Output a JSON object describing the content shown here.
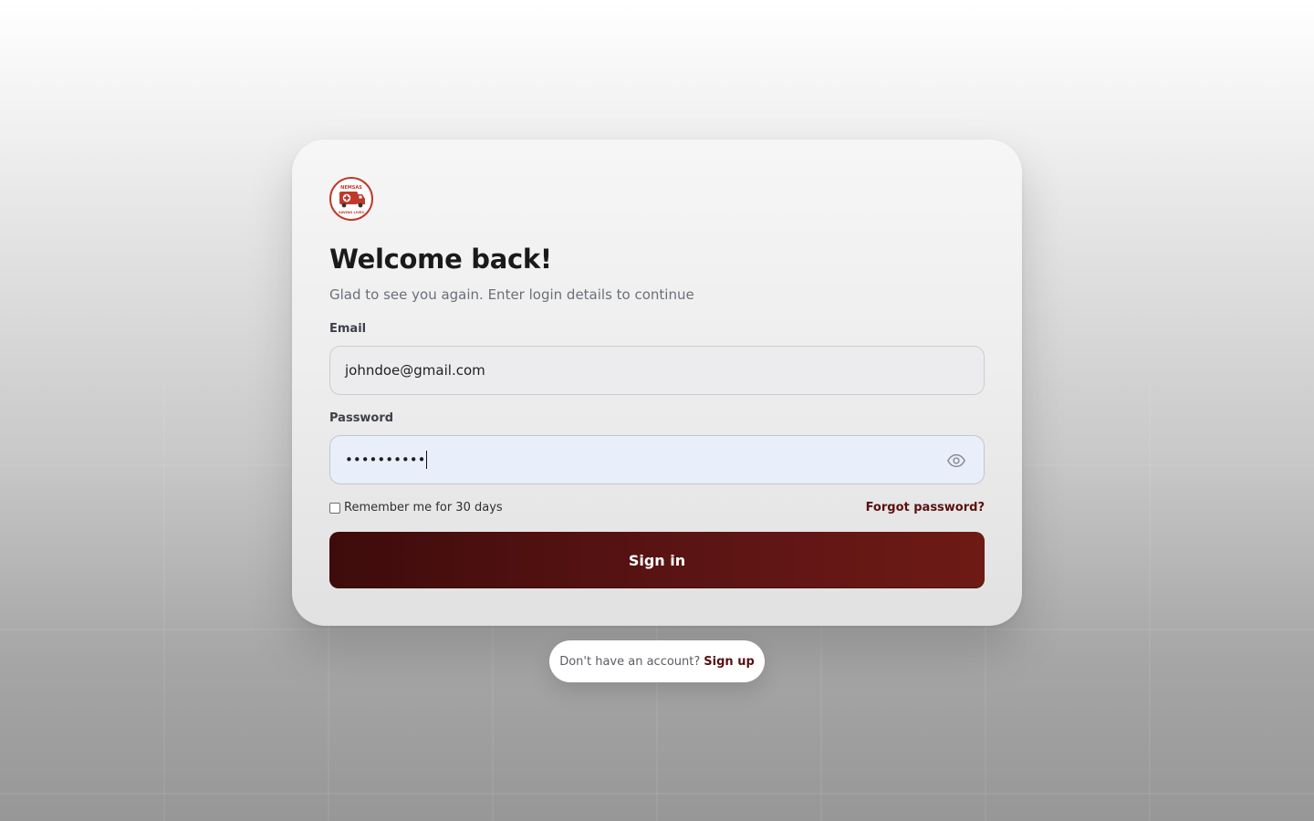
{
  "brand": {
    "logo_icon": "ambulance-logo-icon",
    "logo_top_text": "NEMSAS",
    "logo_bottom_text": "SAVING LIVES",
    "accent_color": "#5a1010",
    "logo_color": "#c0392b"
  },
  "login": {
    "title": "Welcome back!",
    "subtitle": "Glad to see you again. Enter login details to continue",
    "email_label": "Email",
    "email_value": "johndoe@gmail.com",
    "password_label": "Password",
    "password_value": "••••••••••",
    "show_password_icon": "eye-icon",
    "remember_label": "Remember me for 30 days",
    "remember_checked": false,
    "forgot_label": "Forgot password?",
    "signin_label": "Sign in"
  },
  "signup": {
    "prompt": "Don't have an account?",
    "link": "Sign up"
  }
}
